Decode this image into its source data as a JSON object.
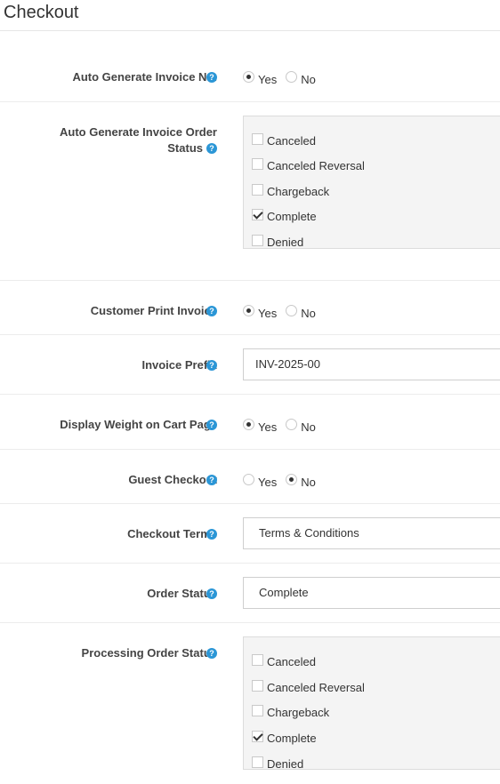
{
  "page": {
    "title": "Checkout"
  },
  "help_glyph": "?",
  "statuses": [
    "Canceled",
    "Canceled Reversal",
    "Chargeback",
    "Complete",
    "Denied"
  ],
  "fields": {
    "auto_invoice_no": {
      "label": "Auto Generate Invoice No.",
      "yes": "Yes",
      "no": "No",
      "selected": "Yes"
    },
    "auto_invoice_order_status": {
      "label_line1": "Auto Generate Invoice Order",
      "label_line2": "Status",
      "checked": [
        "Complete"
      ]
    },
    "customer_print_invoice": {
      "label": "Customer Print Invoice",
      "yes": "Yes",
      "no": "No",
      "selected": "Yes"
    },
    "invoice_prefix": {
      "label": "Invoice Prefix",
      "value": "INV-2025-00"
    },
    "display_weight": {
      "label": "Display Weight on Cart Page",
      "yes": "Yes",
      "no": "No",
      "selected": "Yes"
    },
    "guest_checkout": {
      "label": "Guest Checkout",
      "yes": "Yes",
      "no": "No",
      "selected": "No"
    },
    "checkout_terms": {
      "label": "Checkout Terms",
      "value": "Terms & Conditions"
    },
    "order_status": {
      "label": "Order Status",
      "value": "Complete"
    },
    "processing_order_status": {
      "label": "Processing Order Status",
      "checked": [
        "Complete"
      ]
    }
  }
}
